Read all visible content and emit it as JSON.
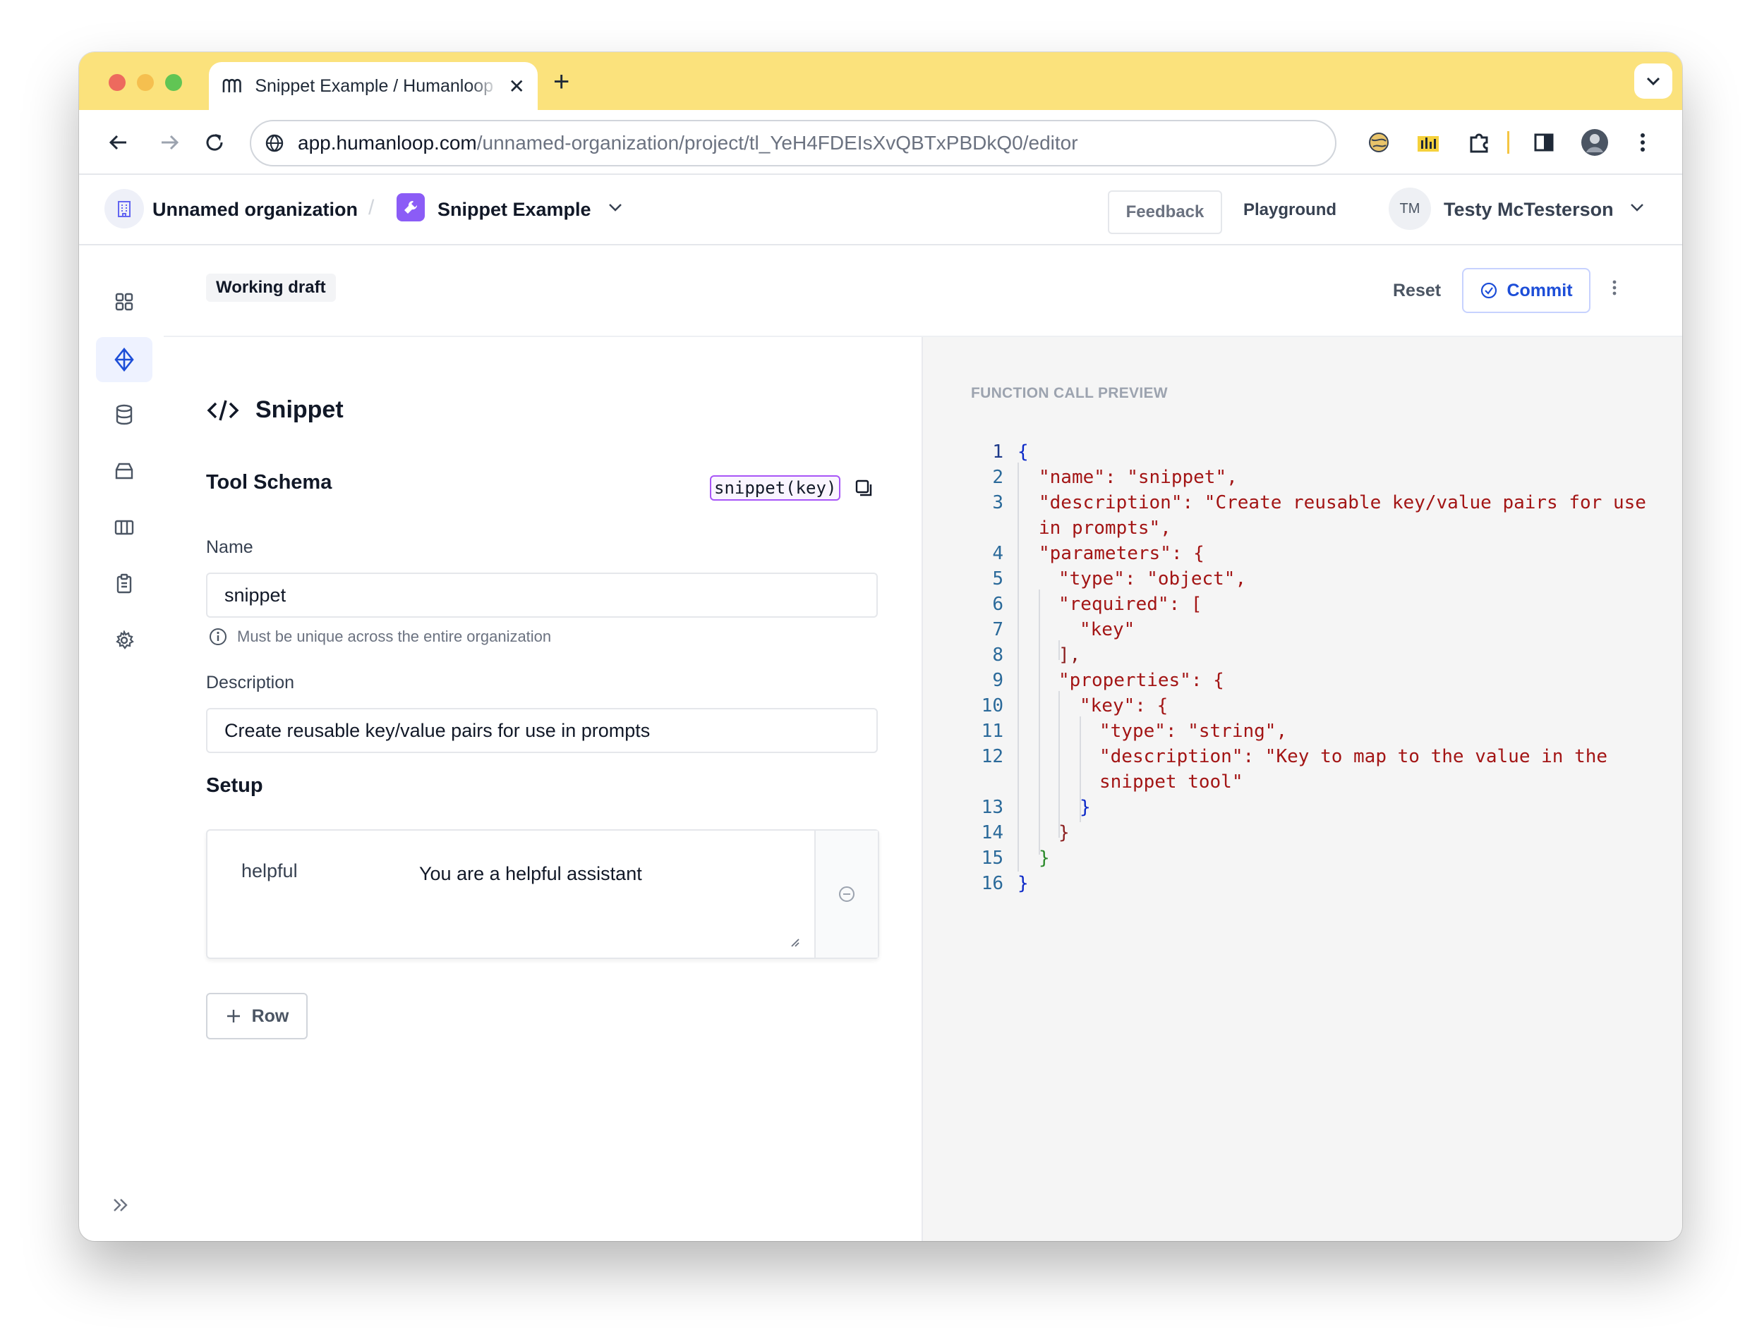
{
  "browser": {
    "tab_title": "Snippet Example / Humanloop",
    "url_host": "app.humanloop.com",
    "url_path": "/unnamed-organization/project/tl_YeH4FDEIsXvQBTxPBDkQ0/editor",
    "icons": [
      "back-arrow-icon",
      "forward-arrow-icon",
      "reload-icon",
      "site-info-icon",
      "extension-icon",
      "puzzle-icon",
      "sidebar-icon",
      "profile-icon",
      "kebab-icon"
    ],
    "tab_strip_color": "#fbe27c"
  },
  "header": {
    "org_name": "Unnamed organization",
    "separator": "/",
    "project_name": "Snippet Example",
    "feedback_label": "Feedback",
    "playground_label": "Playground",
    "user_initials": "TM",
    "user_name": "Testy McTesterson",
    "project_icon_color": "#8b5cf6"
  },
  "toolbar": {
    "draft_label": "Working draft",
    "reset_label": "Reset",
    "commit_label": "Commit",
    "accent": "#1d4ed8"
  },
  "sidebar": {
    "items": [
      {
        "icon": "grid-icon"
      },
      {
        "icon": "diamond-icon",
        "active": true
      },
      {
        "icon": "database-icon"
      },
      {
        "icon": "archive-icon"
      },
      {
        "icon": "columns-icon"
      },
      {
        "icon": "clipboard-icon"
      },
      {
        "icon": "gear-icon"
      }
    ]
  },
  "form": {
    "title": "Snippet",
    "schema_title": "Tool Schema",
    "signature": "snippet(key)",
    "name_label": "Name",
    "name_value": "snippet",
    "name_hint": "Must be unique across the entire organization",
    "description_label": "Description",
    "description_value": "Create reusable key/value pairs for use in prompts",
    "setup_title": "Setup",
    "setup_rows": [
      {
        "key": "helpful",
        "value": "You are a helpful assistant"
      }
    ],
    "add_row_label": "Row"
  },
  "preview": {
    "label": "FUNCTION CALL PREVIEW",
    "line_numbers": [
      "1",
      "2",
      "3",
      "4",
      "5",
      "6",
      "7",
      "8",
      "9",
      "10",
      "11",
      "12",
      "13",
      "14",
      "15",
      "16"
    ],
    "lines": [
      "{",
      "\"name\": \"snippet\",",
      "\"description\": \"Create reusable key/value pairs for use",
      "in prompts\",",
      "\"parameters\": {",
      "\"type\": \"object\",",
      "\"required\": [",
      "\"key\"",
      "],",
      "\"properties\": {",
      "\"key\": {",
      "\"type\": \"string\",",
      "\"description\": \"Key to map to the value in the",
      "snippet tool\"",
      "}",
      "}",
      "}",
      "}"
    ]
  }
}
